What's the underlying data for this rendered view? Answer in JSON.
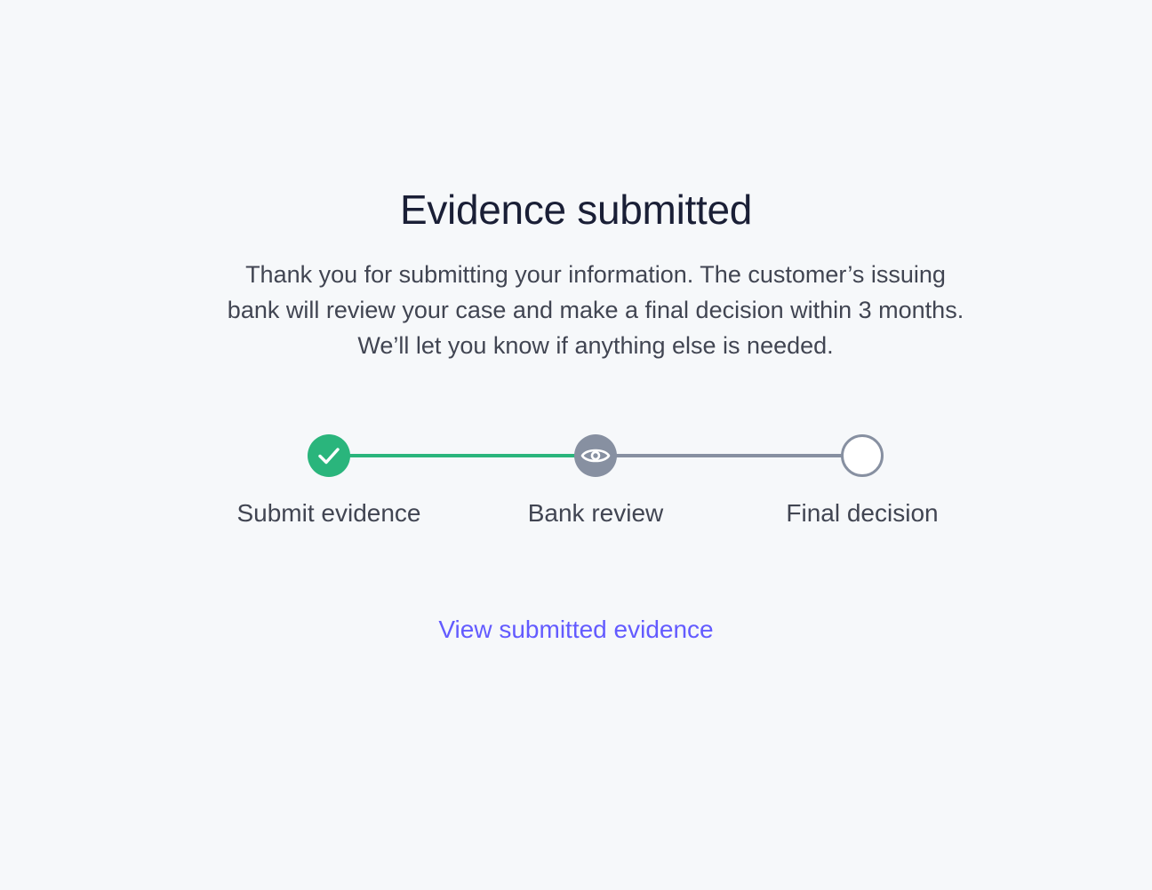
{
  "header": {
    "title": "Evidence submitted"
  },
  "description": "Thank you for submitting your information. The customer’s issuing bank will review your case and make a final decision within 3 months. We’ll let you know if anything else is needed.",
  "colors": {
    "complete": "#2ab57c",
    "current": "#8790a1",
    "pending_border": "#8790a1",
    "pending_fill": "#ffffff",
    "link": "#635bff"
  },
  "steps": [
    {
      "label": "Submit evidence",
      "status": "complete",
      "icon": "check-icon"
    },
    {
      "label": "Bank review",
      "status": "current",
      "icon": "eye-icon"
    },
    {
      "label": "Final decision",
      "status": "pending",
      "icon": "empty-circle-icon"
    }
  ],
  "link": {
    "label": "View submitted evidence"
  }
}
